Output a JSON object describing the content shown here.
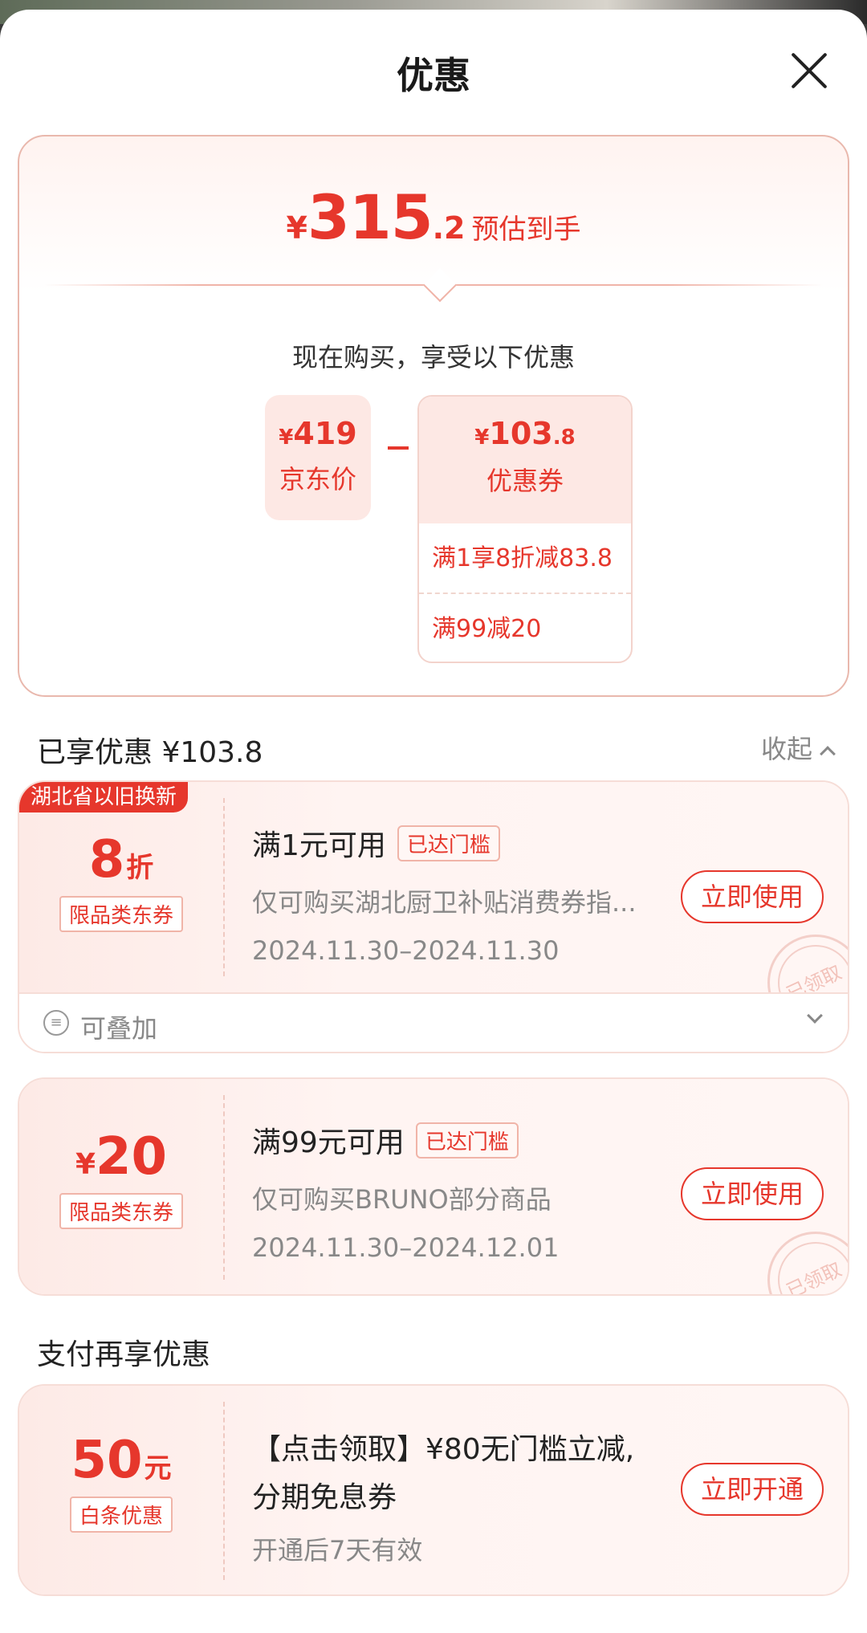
{
  "header": {
    "title": "优惠"
  },
  "summary": {
    "currency": "¥",
    "price_int": "315",
    "price_dec": ".2",
    "estimate_label": "预估到手",
    "buy_now_text": "现在购买，享受以下优惠",
    "jd_price": {
      "currency": "¥",
      "value": "419",
      "label": "京东价"
    },
    "minus": "–",
    "coupon": {
      "currency": "¥",
      "value_int": "103",
      "value_dec": ".8",
      "label": "优惠券",
      "rows": [
        "满1享8折减83.8",
        "满99减20"
      ]
    }
  },
  "enjoyed": {
    "label": "已享优惠 ¥103.8",
    "collapse_label": "收起"
  },
  "coupons": [
    {
      "region_tag": "湖北省以旧换新",
      "amount": "8",
      "amount_unit": "折",
      "type_tag": "限品类东券",
      "condition": "满1元可用",
      "reach_tag": "已达门槛",
      "desc": "仅可购买湖北厨卫补贴消费券指...",
      "date": "2024.11.30–2024.11.30",
      "button": "立即使用",
      "stamp": "已领取",
      "stack_label": "可叠加"
    },
    {
      "amount_prefix": "¥",
      "amount": "20",
      "type_tag": "限品类东券",
      "condition": "满99元可用",
      "reach_tag": "已达门槛",
      "desc": "仅可购买BRUNO部分商品",
      "date": "2024.11.30–2024.12.01",
      "button": "立即使用",
      "stamp": "已领取"
    }
  ],
  "pay_more": {
    "label": "支付再享优惠"
  },
  "baitiao": {
    "amount": "50",
    "amount_unit": "元",
    "type_tag": "白条优惠",
    "line1": "【点击领取】¥80无门槛立减,",
    "line2": "分期免息券",
    "desc": "开通后7天有效",
    "button": "立即开通"
  },
  "colors": {
    "accent": "#e6372c",
    "pink_bg": "#fde8e4"
  }
}
